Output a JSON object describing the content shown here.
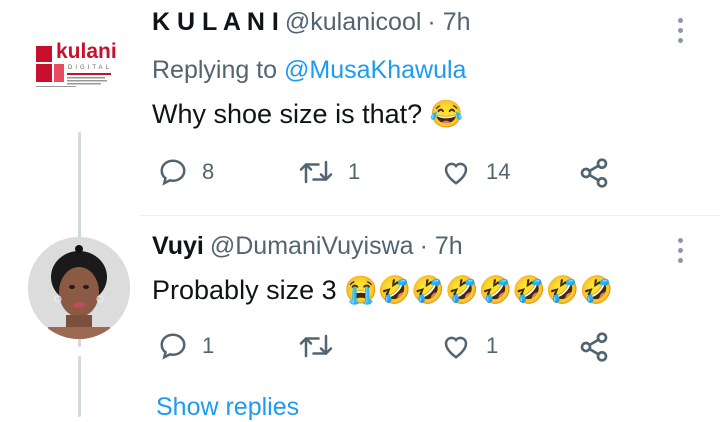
{
  "tweet1": {
    "logo_text": "kulani",
    "logo_sub": "DIGITAL",
    "name": "K U L A N I",
    "handle": "@kulanicool",
    "time": "· 7h",
    "reply_prefix": "Replying to",
    "reply_mention": "@MusaKhawula",
    "text": "Why shoe size is that?",
    "emojis": "😂",
    "replies": "8",
    "retweets": "1",
    "likes": "14",
    "icons": [
      "reply-icon",
      "retweet-icon",
      "like-icon",
      "share-icon",
      "more-icon"
    ]
  },
  "tweet2": {
    "name": "Vuyi",
    "handle": "@DumaniVuyiswa",
    "time": "· 7h",
    "text": "Probably size 3",
    "emojis": "😭🤣🤣🤣🤣🤣🤣🤣",
    "replies": "1",
    "retweets": "",
    "likes": "1",
    "icons": [
      "reply-icon",
      "retweet-icon",
      "like-icon",
      "share-icon",
      "more-icon"
    ]
  },
  "show_replies": "Show replies",
  "colors": {
    "accent": "#1d9bf0",
    "muted": "#536471",
    "text": "#0f1419",
    "logo_red": "#c8102e"
  }
}
